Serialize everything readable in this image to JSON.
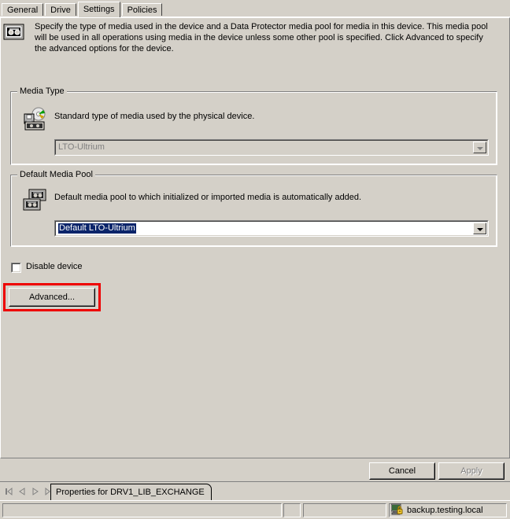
{
  "tabs": [
    {
      "label": "General",
      "active": false
    },
    {
      "label": "Drive",
      "active": false
    },
    {
      "label": "Settings",
      "active": true
    },
    {
      "label": "Policies",
      "active": false
    }
  ],
  "header": {
    "icon": "tape-cartridge-icon",
    "description": "Specify the type of media used in the device and a Data Protector media pool for media in this device. This media pool will be used in all operations using media in the device unless some other pool is specified. Click Advanced to specify the advanced options for the device."
  },
  "media_type_group": {
    "title": "Media Type",
    "icon": "media-type-icon",
    "description": "Standard type of media used by the physical device.",
    "combo": {
      "value": "LTO-Ultrium",
      "disabled": true
    }
  },
  "media_pool_group": {
    "title": "Default Media Pool",
    "icon": "media-pool-icon",
    "description": "Default media pool to which initialized or imported media is automatically added.",
    "combo": {
      "value": "Default LTO-Ultrium",
      "disabled": false,
      "selected": true
    }
  },
  "disable_device": {
    "label": "Disable device",
    "checked": false
  },
  "buttons": {
    "advanced": "Advanced...",
    "cancel": "Cancel",
    "apply": "Apply",
    "apply_disabled": true
  },
  "highlight": {
    "color": "#ee0000",
    "target": "advanced-button"
  },
  "mdi": {
    "nav": {
      "first": "first-record-icon",
      "prev": "previous-record-icon",
      "next": "next-record-icon",
      "last": "last-record-icon"
    },
    "tab_label": "Properties for DRV1_LIB_EXCHANGE"
  },
  "statusbar": {
    "left": "",
    "small": "",
    "mid": "",
    "host_icon": "secure-computer-icon",
    "host": "backup.testing.local"
  },
  "colors": {
    "face": "#d4d0c8",
    "selection": "#0a246a",
    "disabled_text": "#808080",
    "highlight": "#ee0000"
  }
}
